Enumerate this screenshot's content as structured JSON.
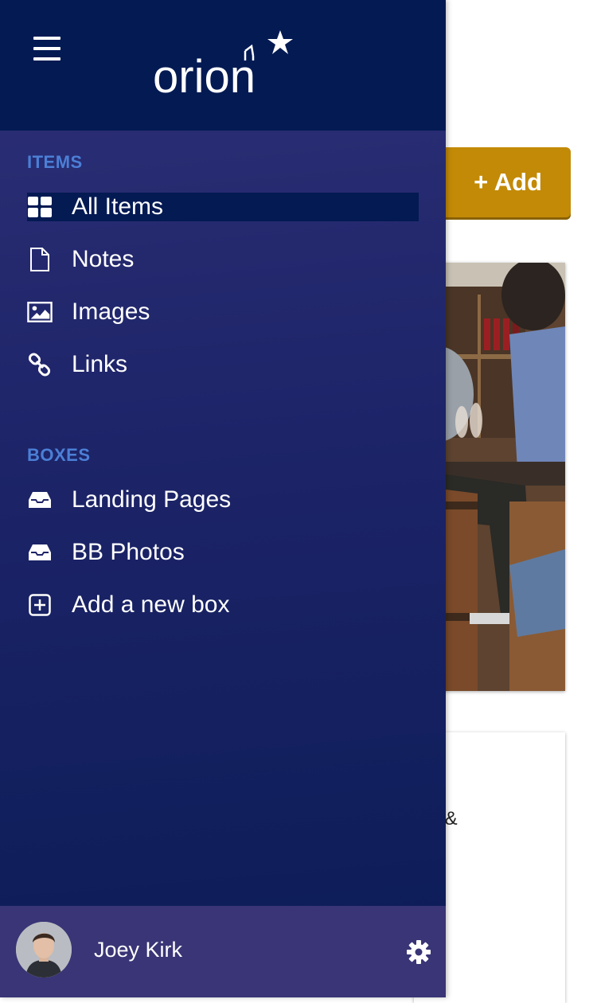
{
  "main": {
    "add_button": "+ Add",
    "card_snippet": "s &"
  },
  "header": {
    "logo_text": "orion"
  },
  "sections": {
    "items_title": "ITEMS",
    "boxes_title": "BOXES"
  },
  "items": [
    {
      "label": "All Items",
      "icon": "grid-icon",
      "active": true
    },
    {
      "label": "Notes",
      "icon": "file-icon",
      "active": false
    },
    {
      "label": "Images",
      "icon": "image-icon",
      "active": false
    },
    {
      "label": "Links",
      "icon": "link-icon",
      "active": false
    }
  ],
  "boxes": [
    {
      "label": "Landing Pages",
      "icon": "inbox-icon"
    },
    {
      "label": "BB Photos",
      "icon": "inbox-icon"
    },
    {
      "label": "Add a new box",
      "icon": "plus-square-icon"
    }
  ],
  "footer": {
    "user_name": "Joey Kirk"
  },
  "colors": {
    "drawer_header": "#031a53",
    "section_title": "#4b7fd6",
    "active_item_bg": "#031a53",
    "footer_bg": "#393576",
    "add_button": "#c38a07"
  }
}
